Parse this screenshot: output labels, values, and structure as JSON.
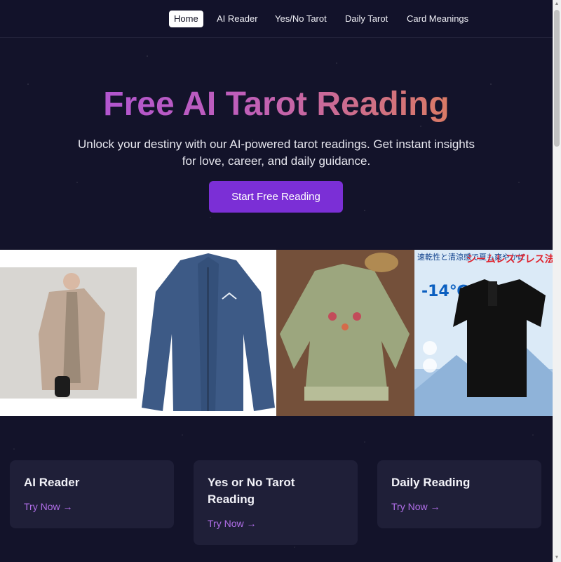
{
  "nav": {
    "items": [
      {
        "label": "Home",
        "active": true
      },
      {
        "label": "AI Reader",
        "active": false
      },
      {
        "label": "Yes/No Tarot",
        "active": false
      },
      {
        "label": "Daily Tarot",
        "active": false
      },
      {
        "label": "Card Meanings",
        "active": false
      }
    ]
  },
  "hero": {
    "title": "Free AI Tarot Reading",
    "subtitle": "Unlock your destiny with our AI-powered tarot readings. Get instant insights for love, career, and daily guidance.",
    "cta_label": "Start Free Reading"
  },
  "ads": {
    "ad4_text_jp_1": "速乾性と清涼感で夏も爽やかに",
    "ad4_text_jp_2": "シームレスプレス法",
    "ad4_temp": "-14℃"
  },
  "cards": [
    {
      "title": "AI Reader",
      "link": "Try Now →"
    },
    {
      "title": "Yes or No Tarot Reading",
      "link": "Try Now →"
    },
    {
      "title": "Daily Reading",
      "link": "Try Now →"
    }
  ],
  "colors": {
    "background": "#13132a",
    "accent": "#7b2fd6",
    "link": "#b06ee8",
    "card": "#1f1f38"
  }
}
